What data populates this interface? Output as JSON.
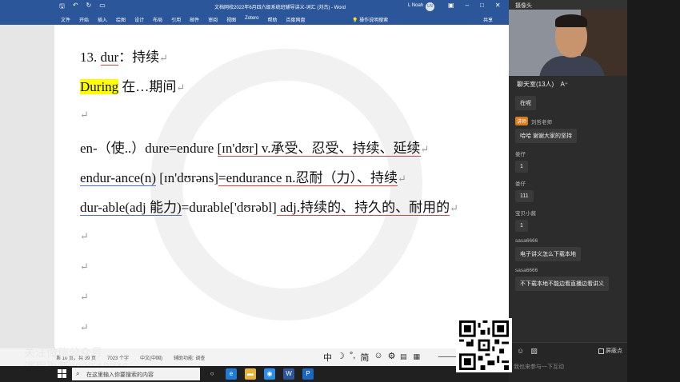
{
  "word": {
    "title": "文档网校2022年6月四六级系统班辅导讲义-词汇 (刘杰) - Word",
    "user": "L Noah",
    "avatar": "LN",
    "tabs": [
      "文件",
      "开始",
      "插入",
      "绘图",
      "设计",
      "布局",
      "引用",
      "邮件",
      "审阅",
      "视图",
      "Zotero",
      "帮助",
      "百度网盘"
    ],
    "tellme": "操作说明搜索",
    "share": "共享",
    "statusbar": [
      "第 10 页，共 39 页",
      "7023 个字",
      "中文(中国)",
      "辅助功能: 调查"
    ],
    "ime": [
      "中",
      "简"
    ]
  },
  "document": {
    "lines": [
      {
        "prefix": "13.",
        "word": "dur",
        "sep": "：",
        "meaning": "持续"
      },
      {
        "hl": "During",
        "rest": " 在…期间"
      },
      {
        "text": ""
      },
      {
        "a": "en-（使..）dure=endure",
        "b": "[ɪn'dʊr]",
        "c": " v.承受、忍受、持续、延续"
      },
      {
        "a": "endur-ance(n)",
        "b": "[ɪn'dʊrəns]",
        "c": "=endurance n.忍耐（力）、持续"
      },
      {
        "a": "dur-able(adj 能力)",
        "b": "=durable['dʊrəbl]",
        "c": " adj.持续的、持久的、耐用的"
      }
    ],
    "para_mark": "↵"
  },
  "overlay": {
    "line1": "关注微信公众号",
    "line2": "课程更新2000",
    "tail": "10346"
  },
  "taskbar": {
    "search_placeholder": "在这里输入你要搜索的内容"
  },
  "panel": {
    "header": "摄像头",
    "room_title": "聊天室(13人)",
    "font_btn": "A⁺",
    "messages": [
      {
        "user": "",
        "role": "",
        "text": "在呢"
      },
      {
        "user": "刘哲老师",
        "role": "讲师",
        "text": "哈哈 谢谢大家的坚持"
      },
      {
        "user": "娄仔",
        "role": "",
        "text": "1"
      },
      {
        "user": "娄仔",
        "role": "",
        "text": "111"
      },
      {
        "user": "宝贝小酱",
        "role": "",
        "text": "1"
      },
      {
        "user": "sasa6666",
        "role": "",
        "text": "电子讲义怎么下载本地"
      },
      {
        "user": "sasa6666",
        "role": "",
        "text": "不下载本地不能边看直播边看讲义"
      }
    ],
    "block_label": "屏蔽点",
    "input_placeholder": "我也来参与一下互动"
  }
}
